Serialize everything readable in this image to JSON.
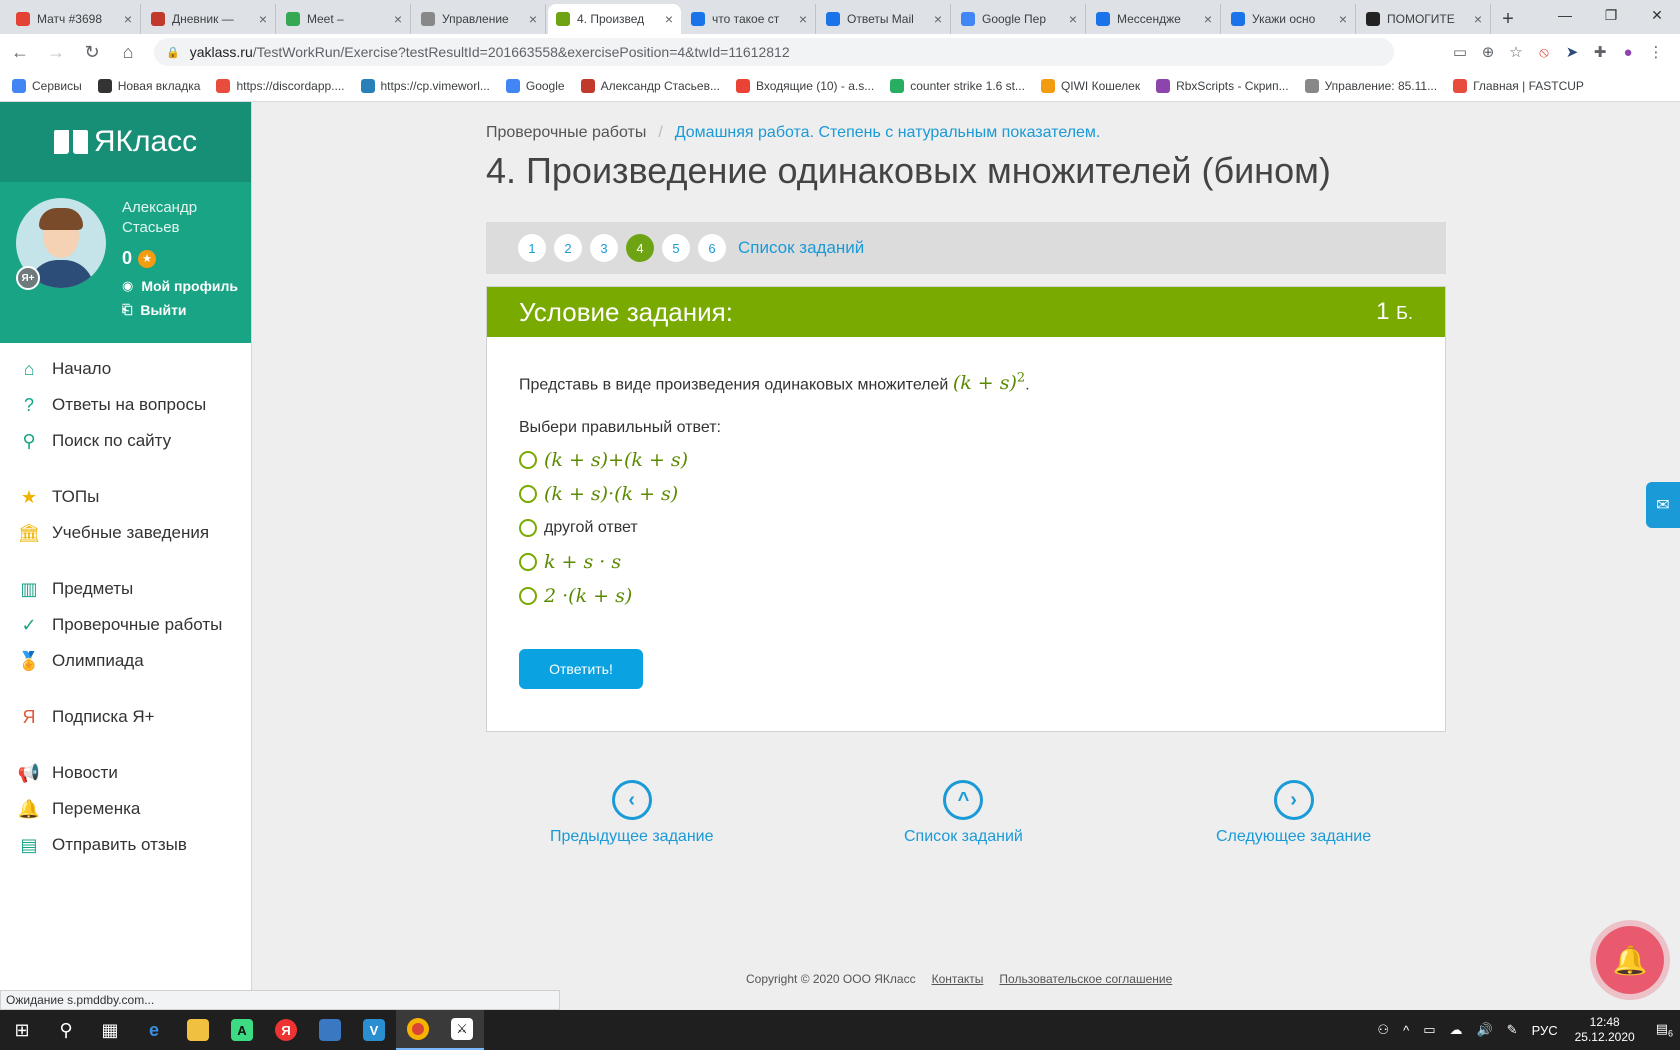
{
  "browser": {
    "tabs": [
      {
        "title": "Матч #3698",
        "color": "#e34234",
        "icon": "shield-icon"
      },
      {
        "title": "Дневник —",
        "color": "#c0392b",
        "icon": "diary-icon"
      },
      {
        "title": "Meet – ",
        "color": "#34a853",
        "icon": "meet-icon"
      },
      {
        "title": "Управление",
        "color": "#888888",
        "icon": "steam-icon"
      },
      {
        "title": "4. Произвед",
        "color": "#6ea413",
        "icon": "yaklass-icon"
      },
      {
        "title": "что такое ст",
        "color": "#1a73e8",
        "icon": "search-icon"
      },
      {
        "title": "Ответы Mail",
        "color": "#1a73e8",
        "icon": "question-icon"
      },
      {
        "title": "Google Пер",
        "color": "#4285f4",
        "icon": "translate-icon"
      },
      {
        "title": "Мессендже",
        "color": "#1a73e8",
        "icon": "chat-icon"
      },
      {
        "title": "Укажи осно",
        "color": "#1a73e8",
        "icon": "search-icon"
      },
      {
        "title": "ПОМОГИТЕ",
        "color": "#222222",
        "icon": "znanija-icon"
      }
    ],
    "url_host": "yaklass.ru",
    "url_path": "/TestWorkRun/Exercise?testResultId=201663558&exercisePosition=4&twId=11612812",
    "bookmarks": [
      {
        "label": "Сервисы",
        "color": "#4285f4"
      },
      {
        "label": "Новая вкладка",
        "color": "#333333"
      },
      {
        "label": "https://discordapp....",
        "color": "#e74c3c"
      },
      {
        "label": "https://cp.vimeworl...",
        "color": "#2980b9"
      },
      {
        "label": "Google",
        "color": "#4285f4"
      },
      {
        "label": "Александр Стасьев...",
        "color": "#c0392b"
      },
      {
        "label": "Входящие (10) - a.s...",
        "color": "#ea4335"
      },
      {
        "label": "counter strike 1.6 st...",
        "color": "#27ae60"
      },
      {
        "label": "QIWI Кошелек",
        "color": "#f39c12"
      },
      {
        "label": "RbxScripts - Скрип...",
        "color": "#8e44ad"
      },
      {
        "label": "Управление: 85.11...",
        "color": "#888888"
      },
      {
        "label": "Главная | FASTCUP",
        "color": "#e74c3c"
      }
    ],
    "status": "Ожидание s.pmddby.com..."
  },
  "sidebar": {
    "logo": "ЯКласс",
    "user_name": "Александр Стасьев",
    "score": "0",
    "profile_link": "Мой профиль",
    "logout_link": "Выйти",
    "menu": [
      {
        "label": "Начало",
        "icon": "home-icon",
        "glyph": "⌂"
      },
      {
        "label": "Ответы на вопросы",
        "icon": "question-circle-icon",
        "glyph": "?"
      },
      {
        "label": "Поиск по сайту",
        "icon": "search-icon",
        "glyph": "⚲"
      },
      {
        "label": "ТОПы",
        "icon": "star-icon",
        "glyph": "★"
      },
      {
        "label": "Учебные заведения",
        "icon": "school-icon",
        "glyph": "🏛"
      },
      {
        "label": "Предметы",
        "icon": "books-icon",
        "glyph": "▥"
      },
      {
        "label": "Проверочные работы",
        "icon": "check-circle-icon",
        "glyph": "✓"
      },
      {
        "label": "Олимпиада",
        "icon": "medal-icon",
        "glyph": "🏅"
      },
      {
        "label": "Подписка Я+",
        "icon": "ya-plus-icon",
        "glyph": "Я"
      },
      {
        "label": "Новости",
        "icon": "megaphone-icon",
        "glyph": "📢"
      },
      {
        "label": "Переменка",
        "icon": "bell-icon",
        "glyph": "🔔"
      },
      {
        "label": "Отправить отзыв",
        "icon": "feedback-icon",
        "glyph": "▤"
      }
    ]
  },
  "main": {
    "breadcrumb_root": "Проверочные работы",
    "breadcrumb_current": "Домашняя работа. Степень с натуральным показателем.",
    "title": "4. Произведение одинаковых множителей (бином)",
    "pager": [
      "1",
      "2",
      "3",
      "4",
      "5",
      "6"
    ],
    "pager_current": "4",
    "pager_list": "Список заданий",
    "task_header": "Условие задания:",
    "task_points": "1",
    "task_points_unit": "Б.",
    "question_text": "Представь в виде произведения одинаковых множителей",
    "question_expr": "(k + s)",
    "question_power": "2",
    "question_end": ".",
    "choose_label": "Выбери правильный ответ:",
    "options": [
      {
        "text": "(k + s)+(k + s)",
        "math": true
      },
      {
        "text": "(k + s)·(k + s)",
        "math": true
      },
      {
        "text": "другой ответ",
        "math": false
      },
      {
        "text": "k + s · s",
        "math": true
      },
      {
        "text": "2 ·(k + s)",
        "math": true
      }
    ],
    "answer_button": "Ответить!",
    "nav_prev": "Предыдущее задание",
    "nav_list": "Список заданий",
    "nav_next": "Следующее задание",
    "footer_copyright": "Copyright © 2020 ООО ЯКласс",
    "footer_contacts": "Контакты",
    "footer_terms": "Пользовательское соглашение"
  },
  "taskbar": {
    "lang": "РУС",
    "time": "12:48",
    "date": "25.12.2020",
    "notifications": "6"
  }
}
